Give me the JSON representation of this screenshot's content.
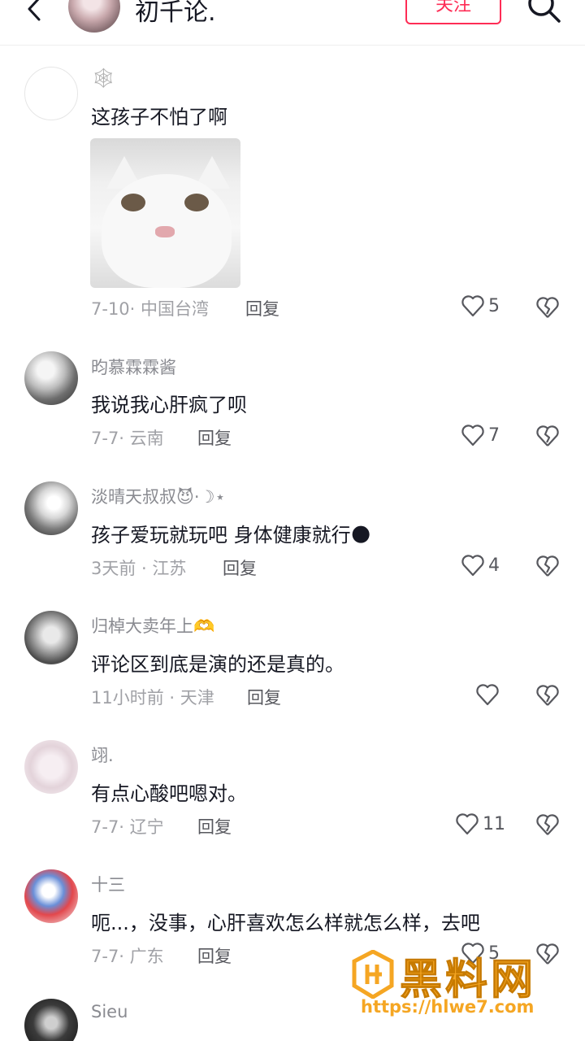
{
  "header": {
    "username": "初千论.",
    "follow_label": "关注"
  },
  "comments": [
    {
      "username": "🕸",
      "text": "这孩子不怕了啊",
      "meta": "7-10· 中国台湾",
      "reply": "回复",
      "likes": "5",
      "has_image": true
    },
    {
      "username": "昀慕霖霖酱",
      "text": "我说我心肝疯了呗",
      "meta": "7-7· 云南",
      "reply": "回复",
      "likes": "7"
    },
    {
      "username": "淡晴天叔叔😈·☽⋆",
      "text": "孩子爱玩就玩吧 身体健康就行🌑",
      "meta": "3天前 · 江苏",
      "reply": "回复",
      "likes": "4"
    },
    {
      "username": "归棹大卖年上🫶",
      "text": "评论区到底是演的还是真的。",
      "meta": "11小时前 · 天津",
      "reply": "回复",
      "likes": ""
    },
    {
      "username": "翊.",
      "text": "有点心酸吧嗯对。",
      "meta": "7-7· 辽宁",
      "reply": "回复",
      "likes": "11"
    },
    {
      "username": "十三",
      "text": "呃...，没事，心肝喜欢怎么样就怎么样，去吧",
      "meta": "7-7· 广东",
      "reply": "回复",
      "likes": "5"
    },
    {
      "username": "Sieu",
      "text": "",
      "meta": "",
      "reply": "",
      "likes": ""
    }
  ],
  "watermark": {
    "title": "黑料网",
    "url": "https://hlwe7.com"
  },
  "colors": {
    "accent": "#fe2c55",
    "watermark": "#f5a623"
  }
}
